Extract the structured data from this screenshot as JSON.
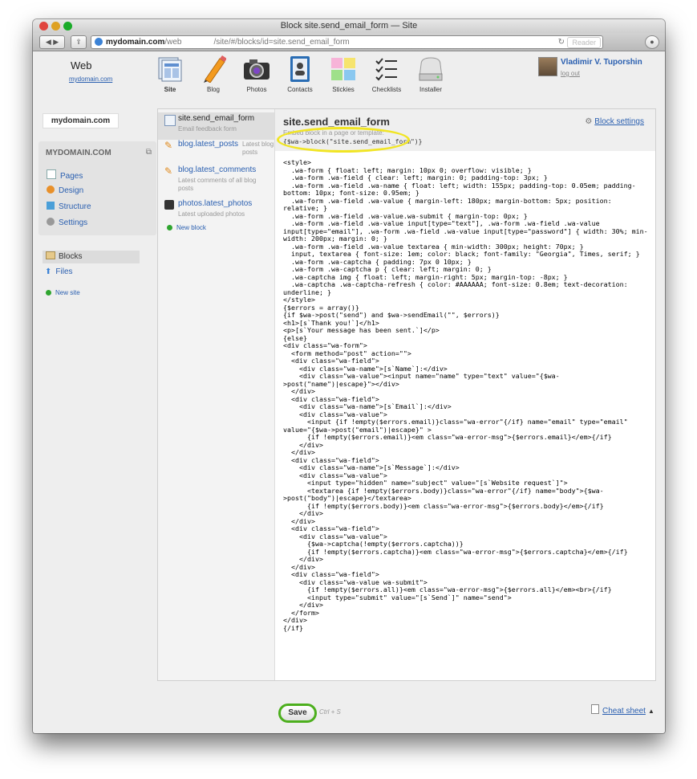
{
  "window": {
    "title": "Block site.send_email_form — Site",
    "url_host": "mydomain.com",
    "url_path_a": "/web",
    "url_path_b": "/site/#/blocks/id=site.send_email_form",
    "reader_label": "Reader"
  },
  "header": {
    "site_title": "Web",
    "site_link": "mydomain.com",
    "apps": [
      {
        "label": "Site"
      },
      {
        "label": "Blog"
      },
      {
        "label": "Photos"
      },
      {
        "label": "Contacts"
      },
      {
        "label": "Stickies"
      },
      {
        "label": "Checklists"
      },
      {
        "label": "Installer"
      }
    ],
    "user_name": "Vladimir V. Tuporshin",
    "logout": "log out"
  },
  "sidebar": {
    "domain": "mydomain.com",
    "section_title": "MYDOMAIN.COM",
    "items": [
      {
        "label": "Pages"
      },
      {
        "label": "Design"
      },
      {
        "label": "Structure"
      },
      {
        "label": "Settings"
      }
    ],
    "blocks_label": "Blocks",
    "files_label": "Files",
    "new_site": "New site"
  },
  "blocks": {
    "list": [
      {
        "name": "site.send_email_form",
        "desc": "Email feedback form"
      },
      {
        "name": "blog.latest_posts",
        "desc": "Latest blog posts"
      },
      {
        "name": "blog.latest_comments",
        "desc": "Latest comments of all blog posts"
      },
      {
        "name": "photos.latest_photos",
        "desc": "Latest uploaded photos"
      }
    ],
    "new_block": "New block"
  },
  "editor": {
    "title": "site.send_email_form",
    "subtitle": "Embed block in a page or template:",
    "embed_code": "{$wa->block(\"site.send_email_form\")}",
    "settings_link": "Block settings",
    "code": "<style>\n  .wa-form { float: left; margin: 10px 0; overflow: visible; }\n  .wa-form .wa-field { clear: left; margin: 0; padding-top: 3px; }\n  .wa-form .wa-field .wa-name { float: left; width: 155px; padding-top: 0.05em; padding-bottom: 10px; font-size: 0.95em; }\n  .wa-form .wa-field .wa-value { margin-left: 180px; margin-bottom: 5px; position: relative; }\n  .wa-form .wa-field .wa-value.wa-submit { margin-top: 0px; }\n  .wa-form .wa-field .wa-value input[type=\"text\"], .wa-form .wa-field .wa-value input[type=\"email\"], .wa-form .wa-field .wa-value input[type=\"password\"] { width: 30%; min-width: 200px; margin: 0; }\n  .wa-form .wa-field .wa-value textarea { min-width: 300px; height: 70px; }\n  input, textarea { font-size: 1em; color: black; font-family: \"Georgia\", Times, serif; }\n  .wa-form .wa-captcha { padding: 7px 0 10px; }\n  .wa-form .wa-captcha p { clear: left; margin: 0; }\n  .wa-captcha img { float: left; margin-right: 5px; margin-top: -8px; }\n  .wa-captcha .wa-captcha-refresh { color: #AAAAAA; font-size: 0.8em; text-decoration: underline; }\n</style>\n{$errors = array()}\n{if $wa->post(\"send\") and $wa->sendEmail(\"\", $errors)}\n<h1>[s`Thank you!`]</h1>\n<p>[s`Your message has been sent.`]</p>\n{else}\n<div class=\"wa-form\">\n  <form method=\"post\" action=\"\">\n  <div class=\"wa-field\">\n    <div class=\"wa-name\">[s`Name`]:</div>\n    <div class=\"wa-value\"><input name=\"name\" type=\"text\" value=\"{$wa->post(\"name\")|escape}\"></div>\n  </div>\n  <div class=\"wa-field\">\n    <div class=\"wa-name\">[s`Email`]:</div>\n    <div class=\"wa-value\">\n      <input {if !empty($errors.email)}class=\"wa-error\"{/if} name=\"email\" type=\"email\" value=\"{$wa->post(\"email\")|escape}\" >\n      {if !empty($errors.email)}<em class=\"wa-error-msg\">{$errors.email}</em>{/if}\n    </div>\n  </div>\n  <div class=\"wa-field\">\n    <div class=\"wa-name\">[s`Message`]:</div>\n    <div class=\"wa-value\">\n      <input type=\"hidden\" name=\"subject\" value=\"[s`Website request`]\">\n      <textarea {if !empty($errors.body)}class=\"wa-error\"{/if} name=\"body\">{$wa->post(\"body\")|escape}</textarea>\n      {if !empty($errors.body)}<em class=\"wa-error-msg\">{$errors.body}</em>{/if}\n    </div>\n  </div>\n  <div class=\"wa-field\">\n    <div class=\"wa-value\">\n      {$wa->captcha(!empty($errors.captcha))}\n      {if !empty($errors.captcha)}<em class=\"wa-error-msg\">{$errors.captcha}</em>{/if}\n    </div>\n  </div>\n  <div class=\"wa-field\">\n    <div class=\"wa-value wa-submit\">\n      {if !empty($errors.all)}<em class=\"wa-error-msg\">{$errors.all}</em><br>{/if}\n      <input type=\"submit\" value=\"[s`Send`]\" name=\"send\">\n    </div>\n  </form>\n</div>\n{/if}"
  },
  "footer": {
    "save_label": "Save",
    "shortcut": "Ctrl + S",
    "cheat_sheet": "Cheat sheet"
  },
  "colors": {
    "accent_link": "#2a5fb0",
    "save_border": "#4caf1d",
    "highlight": "#f1e524"
  }
}
